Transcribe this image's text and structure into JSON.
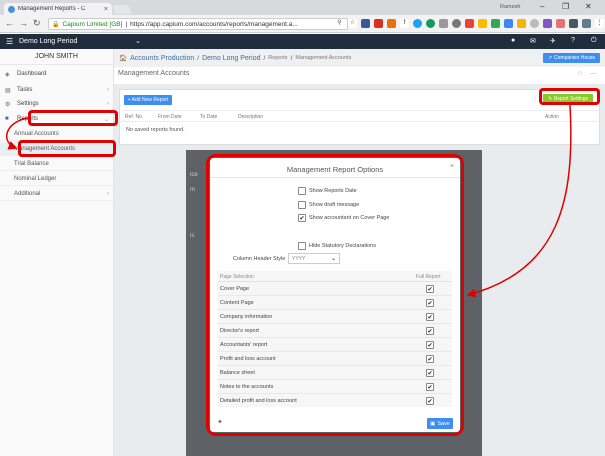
{
  "browser": {
    "tab_title": "Management Reports - C",
    "tab_close": "×",
    "profile_name": "Ramesh",
    "window_controls": [
      "–",
      "❐",
      "✕"
    ],
    "secure_label": "Capium Limited [GB]",
    "url": "https://app.capium.com/accounts/reports/management.a..."
  },
  "app": {
    "period": "Demo Long Period",
    "user": "JOHN SMITH",
    "companies_house": "Companies House"
  },
  "sidebar": {
    "items": [
      {
        "label": "Dashboard",
        "icon": "dashboard-icon"
      },
      {
        "label": "Tasks",
        "icon": "tasks-icon"
      },
      {
        "label": "Settings",
        "icon": "settings-icon"
      },
      {
        "label": "Reports",
        "icon": "reports-icon"
      }
    ],
    "sub_items": [
      "Annual Accounts",
      "Management Accounts",
      "Trial Balance",
      "Nominal Ledger",
      "Additional"
    ]
  },
  "breadcrumb": {
    "home": "Accounts Production",
    "sep": "/",
    "company": "Demo Long Period",
    "reports": "Reports",
    "current": "Management Accounts"
  },
  "page": {
    "title": "Management Accounts",
    "add_button": "+ Add New Report",
    "report_settings": "Report Settings",
    "columns": [
      "Ref. No.",
      "From Date",
      "To Date",
      "Description",
      "Action"
    ],
    "empty_text": "No saved reports found."
  },
  "overlay_text": [
    "ice",
    "m",
    "is"
  ],
  "modal": {
    "title": "Management Report Options",
    "close": "×",
    "options": [
      {
        "label": "Show Reports Date",
        "checked": false
      },
      {
        "label": "Show draft message",
        "checked": false
      },
      {
        "label": "Show accountant on Cover Page",
        "checked": true
      }
    ],
    "header_style_label": "Column Header Style",
    "header_style_value": "YYYY",
    "hide_statutory": {
      "label": "Hide Statutory Declarations",
      "checked": false
    },
    "table_head": {
      "page": "Page Selection",
      "full": "Full Report"
    },
    "pages": [
      {
        "name": "Cover Page",
        "checked": true
      },
      {
        "name": "Content Page",
        "checked": true
      },
      {
        "name": "Company information",
        "checked": true
      },
      {
        "name": "Director's report",
        "checked": true
      },
      {
        "name": "Accountants' report",
        "checked": true
      },
      {
        "name": "Profit and loss account",
        "checked": true
      },
      {
        "name": "Balance sheet",
        "checked": true
      },
      {
        "name": "Notes to the accounts",
        "checked": true
      },
      {
        "name": "Detailed profit and loss account",
        "checked": true
      }
    ],
    "save": "Save"
  },
  "colors": {
    "highlight": "#e00000",
    "primary": "#3e8ef0",
    "settings_btn": "#8ac926",
    "header": "#1f2d3d"
  }
}
